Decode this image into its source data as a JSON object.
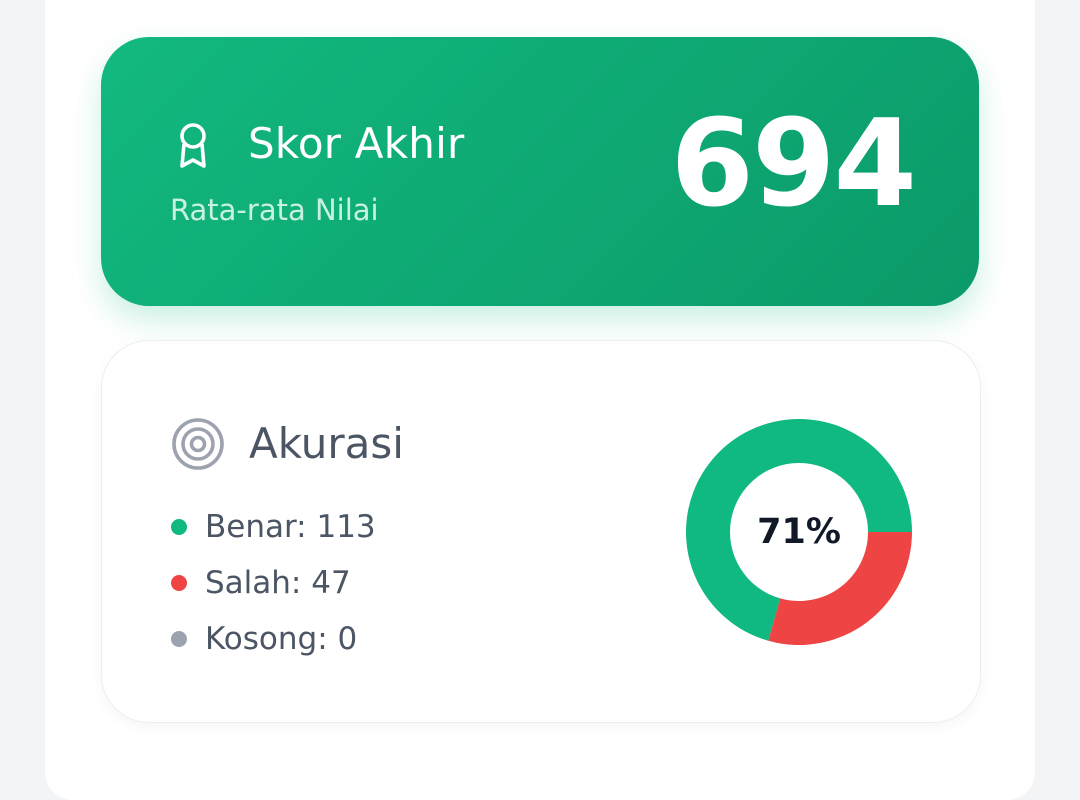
{
  "score": {
    "title": "Skor Akhir",
    "subtitle": "Rata-rata Nilai",
    "value": "694",
    "icon": "award-ribbon-icon"
  },
  "accuracy": {
    "title": "Akurasi",
    "icon": "target-icon",
    "center_label": "71%",
    "legend": [
      {
        "label": "Benar: 113",
        "color": "#10b981"
      },
      {
        "label": "Salah: 47",
        "color": "#ef4444"
      },
      {
        "label": "Kosong: 0",
        "color": "#9ca3af"
      }
    ]
  },
  "chart_data": {
    "type": "pie",
    "categories": [
      "Benar",
      "Salah",
      "Kosong"
    ],
    "values": [
      113,
      47,
      0
    ],
    "colors": [
      "#10b981",
      "#ef4444",
      "#9ca3af"
    ],
    "title": "",
    "center_label": "71%"
  },
  "colors": {
    "brand_green": "#10b981",
    "brand_green_dark": "#0b9a69",
    "error_red": "#ef4444",
    "neutral_gray": "#9ca3af"
  }
}
